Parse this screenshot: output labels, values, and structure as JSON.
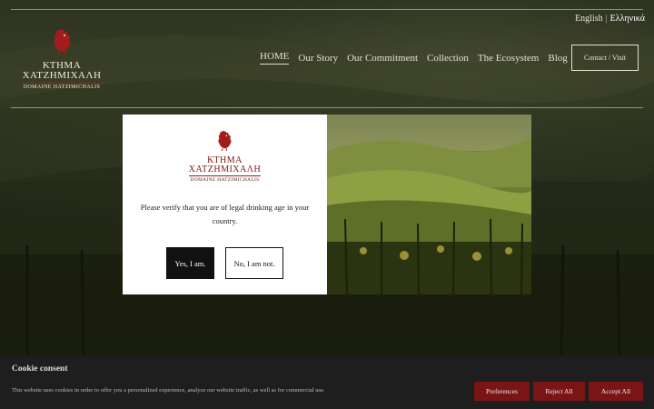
{
  "language": {
    "english": "English",
    "separator": "|",
    "greek": "Ελληνικά"
  },
  "logo": {
    "line1": "ΚΤΗΜΑ",
    "line2": "ΧΑΤΖΗΜΙΧΑΛΗ",
    "line3": "DOMAINE HATZIMICHALIS"
  },
  "nav": {
    "items": [
      "HOME",
      "Our Story",
      "Our Commitment",
      "Collection",
      "The Ecosystem",
      "Blog"
    ],
    "contact": "Contact / Visit"
  },
  "modal": {
    "logo": {
      "line1": "ΚΤΗΜΑ",
      "line2": "ΧΑΤΖΗΜΙΧΑΛΗ",
      "line3": "DOMAINE HATZIMICHALIS"
    },
    "message": "Please verify that you are of legal drinking age in your country.",
    "yes_label": "Yes, I am.",
    "no_label": "No, I am not."
  },
  "cookie": {
    "title": "Cookie consent",
    "text": "This website uses cookies in order to offer you a personalized experience, analyze our website traffic, as well as for commercial use.",
    "preferences": "Preferences",
    "reject": "Reject All",
    "accept": "Accept All"
  },
  "colors": {
    "brand_red": "#a31c1c",
    "button_red": "#7a1515"
  }
}
